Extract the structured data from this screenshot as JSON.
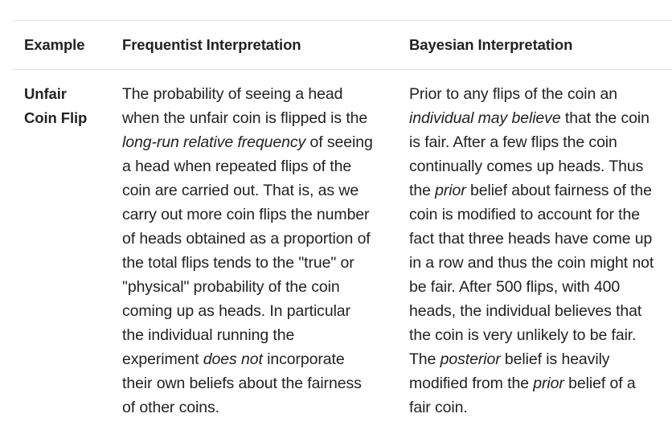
{
  "table": {
    "headers": {
      "example": "Example",
      "frequentist": "Frequentist Interpretation",
      "bayesian": "Bayesian Interpretation"
    },
    "row": {
      "example_line1": "Unfair",
      "example_line2": "Coin Flip",
      "frequentist_lines": [
        [
          {
            "t": "The probability of seeing a head",
            "i": false
          }
        ],
        [
          {
            "t": "when the unfair coin is flipped is the",
            "i": false
          }
        ],
        [
          {
            "t": "long-run relative frequency",
            "i": true
          },
          {
            "t": " of seeing",
            "i": false
          }
        ],
        [
          {
            "t": "a head when repeated flips of the",
            "i": false
          }
        ],
        [
          {
            "t": "coin are carried out. That is, as we",
            "i": false
          }
        ],
        [
          {
            "t": "carry out more coin flips the number",
            "i": false
          }
        ],
        [
          {
            "t": "of heads obtained as a proportion of",
            "i": false
          }
        ],
        [
          {
            "t": "the total flips tends to the \"true\" or",
            "i": false
          }
        ],
        [
          {
            "t": "\"physical\" probability of the coin",
            "i": false
          }
        ],
        [
          {
            "t": "coming up as heads. In particular",
            "i": false
          }
        ],
        [
          {
            "t": "the individual running the",
            "i": false
          }
        ],
        [
          {
            "t": "experiment ",
            "i": false
          },
          {
            "t": "does not",
            "i": true
          },
          {
            "t": " incorporate",
            "i": false
          }
        ],
        [
          {
            "t": "their own beliefs about the fairness",
            "i": false
          }
        ],
        [
          {
            "t": "of other coins.",
            "i": false
          }
        ]
      ],
      "bayesian_lines": [
        [
          {
            "t": "Prior to any flips of the coin an",
            "i": false
          }
        ],
        [
          {
            "t": "individual may believe",
            "i": true
          },
          {
            "t": " that the coin",
            "i": false
          }
        ],
        [
          {
            "t": "is fair. After a few flips the coin",
            "i": false
          }
        ],
        [
          {
            "t": "continually comes up heads. Thus",
            "i": false
          }
        ],
        [
          {
            "t": "the ",
            "i": false
          },
          {
            "t": "prior",
            "i": true
          },
          {
            "t": " belief about fairness of the",
            "i": false
          }
        ],
        [
          {
            "t": "coin is modified to account for the",
            "i": false
          }
        ],
        [
          {
            "t": "fact that three heads have come up",
            "i": false
          }
        ],
        [
          {
            "t": "in a row and thus the coin might not",
            "i": false
          }
        ],
        [
          {
            "t": "be fair. After 500 flips, with 400",
            "i": false
          }
        ],
        [
          {
            "t": "heads, the individual believes that",
            "i": false
          }
        ],
        [
          {
            "t": "the coin is very unlikely to be fair.",
            "i": false
          }
        ],
        [
          {
            "t": "The ",
            "i": false
          },
          {
            "t": "posterior",
            "i": true
          },
          {
            "t": " belief is heavily",
            "i": false
          }
        ],
        [
          {
            "t": "modified from the ",
            "i": false
          },
          {
            "t": "prior",
            "i": true
          },
          {
            "t": " belief of a",
            "i": false
          }
        ],
        [
          {
            "t": "fair coin.",
            "i": false
          }
        ]
      ]
    }
  }
}
